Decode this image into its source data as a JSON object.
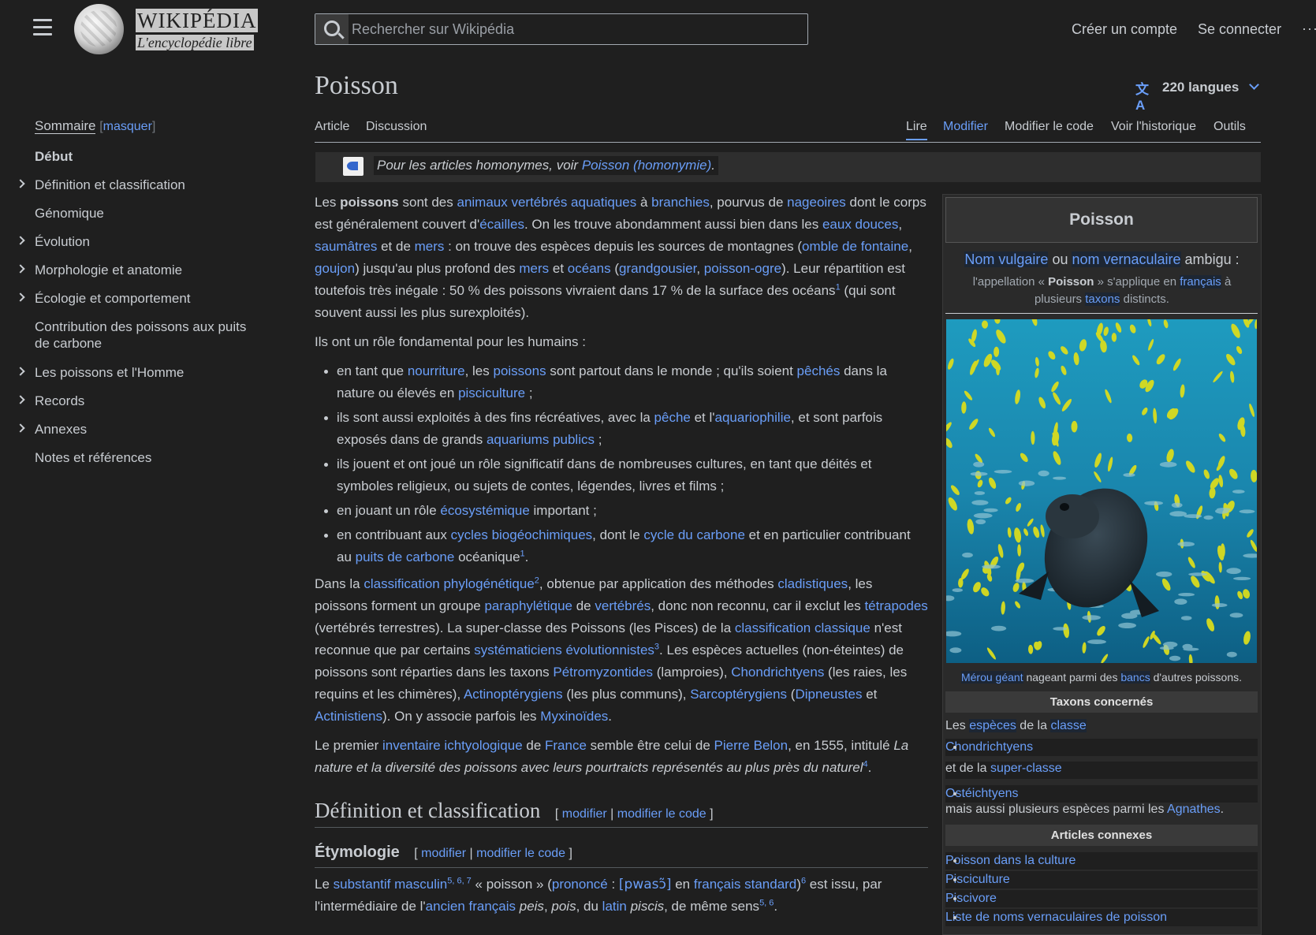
{
  "header": {
    "logo_word": "WIKIPÉDIA",
    "logo_tagline": "L'encyclopédie libre",
    "search_placeholder": "Rechercher sur Wikipédia",
    "create_account": "Créer un compte",
    "login": "Se connecter",
    "more": "···"
  },
  "toc": {
    "title": "Sommaire",
    "hide": "masquer",
    "items": [
      {
        "label": "Début",
        "bold": true,
        "expandable": false
      },
      {
        "label": "Définition et classification",
        "expandable": true
      },
      {
        "label": "Génomique",
        "expandable": false
      },
      {
        "label": "Évolution",
        "expandable": true
      },
      {
        "label": "Morphologie et anatomie",
        "expandable": true
      },
      {
        "label": "Écologie et comportement",
        "expandable": true
      },
      {
        "label": "Contribution des poissons aux puits de carbone",
        "expandable": false
      },
      {
        "label": "Les poissons et l'Homme",
        "expandable": true
      },
      {
        "label": "Records",
        "expandable": true
      },
      {
        "label": "Annexes",
        "expandable": true
      },
      {
        "label": "Notes et références",
        "expandable": false
      }
    ]
  },
  "page": {
    "title": "Poisson",
    "languages": "220 langues",
    "tabs_left": [
      "Article",
      "Discussion"
    ],
    "tabs_right": [
      "Lire",
      "Modifier",
      "Modifier le code",
      "Voir l'historique",
      "Outils"
    ],
    "hatnote_prefix": "Pour les articles homonymes, voir ",
    "hatnote_link": "Poisson (homonymie)",
    "hatnote_suffix": "."
  },
  "sections": {
    "h2_title": "Définition et classification",
    "h3_title": "Étymologie",
    "edit_open": "[",
    "edit_modify": "modifier",
    "edit_sep": "|",
    "edit_code": "modifier le code",
    "edit_close": "]"
  },
  "infobox": {
    "title": "Poisson",
    "ambig_a": "Nom vulgaire",
    "ambig_or": " ou ",
    "ambig_b": "nom vernaculaire",
    "ambig_c": " ambigu :",
    "sub_1": "l'appellation « ",
    "sub_bold": "Poisson",
    "sub_2": " » s'applique en ",
    "sub_link1": "français",
    "sub_3": " à plusieurs ",
    "sub_link2": "taxons",
    "sub_4": " distincts.",
    "caption_link": "Mérou géant",
    "caption_mid": " nageant parmi des ",
    "caption_link2": "bancs",
    "caption_end": " d'autres poissons.",
    "band_taxons": "Taxons concernés",
    "taxons_line1_a": "Les ",
    "taxons_line1_b": "espèces",
    "taxons_line1_c": " de la ",
    "taxons_line1_d": "classe",
    "taxon_1": "Chondrichtyens",
    "taxons_line2_a": "et de la ",
    "taxons_line2_b": "super-classe",
    "taxon_2": "Ostéichtyens",
    "taxons_line3_a": "mais aussi plusieurs espèces parmi les ",
    "taxons_line3_b": "Agnathes",
    "taxons_line3_c": ".",
    "band_articles": "Articles connexes",
    "articles": [
      "Poisson dans la culture",
      "Pisciculture",
      "Piscivore",
      "Liste de noms vernaculaires de poisson"
    ]
  },
  "colors": {
    "link": "#6a9ef8",
    "background": "#1f1f1f",
    "text": "#c8ccd1"
  }
}
